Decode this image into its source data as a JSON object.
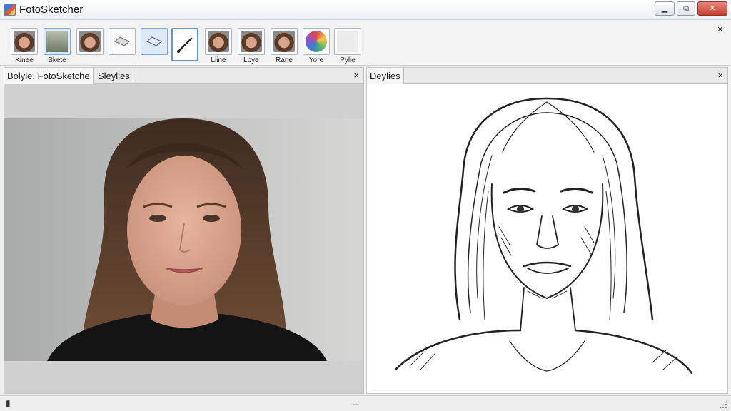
{
  "window": {
    "title": "FotoSketcher",
    "min_label": "▁",
    "max_label": "⧉",
    "close_label": "✕"
  },
  "toolbar": {
    "close_label": "×",
    "tools": [
      {
        "label": "Kinee",
        "icon": "face-thumbnail-icon"
      },
      {
        "label": "Skete",
        "icon": "gradient-thumbnail-icon"
      },
      {
        "label": "",
        "icon": "face-thumbnail-icon"
      },
      {
        "label": "",
        "icon": "eraser-icon"
      },
      {
        "label": "",
        "icon": "eraser-icon"
      },
      {
        "label": "",
        "icon": "pencil-icon"
      },
      {
        "label": "Liine",
        "icon": "face-thumbnail-icon"
      },
      {
        "label": "Loye",
        "icon": "face-thumbnail-icon"
      },
      {
        "label": "Rane",
        "icon": "face-thumbnail-icon"
      },
      {
        "label": "Yore",
        "icon": "color-palette-icon"
      },
      {
        "label": "Pylie",
        "icon": "blank-thumbnail-icon"
      }
    ]
  },
  "left_panel": {
    "tabs": [
      "Bolyle. FotoSketche",
      "Sleylies"
    ],
    "close_label": "×"
  },
  "right_panel": {
    "tabs": [
      "Deylies"
    ],
    "close_label": "×"
  },
  "statusbar": {
    "left": "▮",
    "center": "‥"
  }
}
